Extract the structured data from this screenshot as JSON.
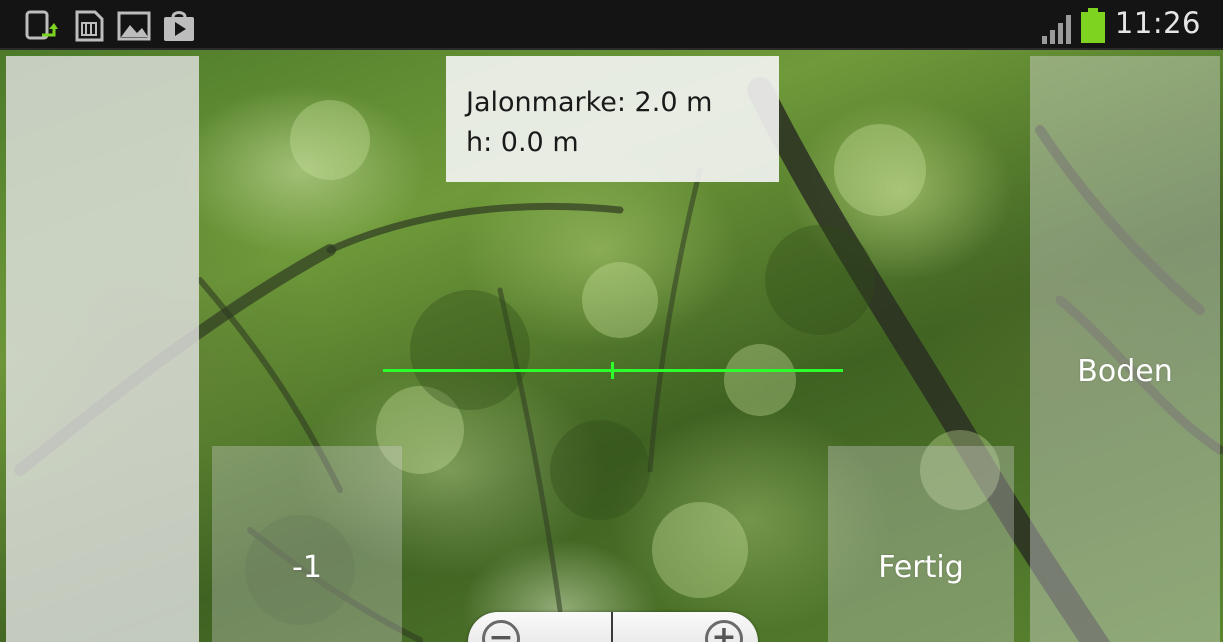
{
  "status_bar": {
    "time": "11:26",
    "notification_icons": [
      "screen-rotate-icon",
      "sd-card-icon",
      "gallery-icon",
      "play-store-icon"
    ],
    "signal_icon": "signal-icon",
    "battery_icon": "battery-icon",
    "battery_color": "#7ed321"
  },
  "info": {
    "jalonmarke": "Jalonmarke: 2.0 m",
    "height": "h: 0.0 m"
  },
  "buttons": {
    "boden": "Boden",
    "minus_one": "-1",
    "fertig": "Fertig"
  },
  "zoom": {
    "zoom_out_symbol": "−",
    "zoom_in_symbol": "+"
  },
  "crosshair_color": "#2dff2d"
}
